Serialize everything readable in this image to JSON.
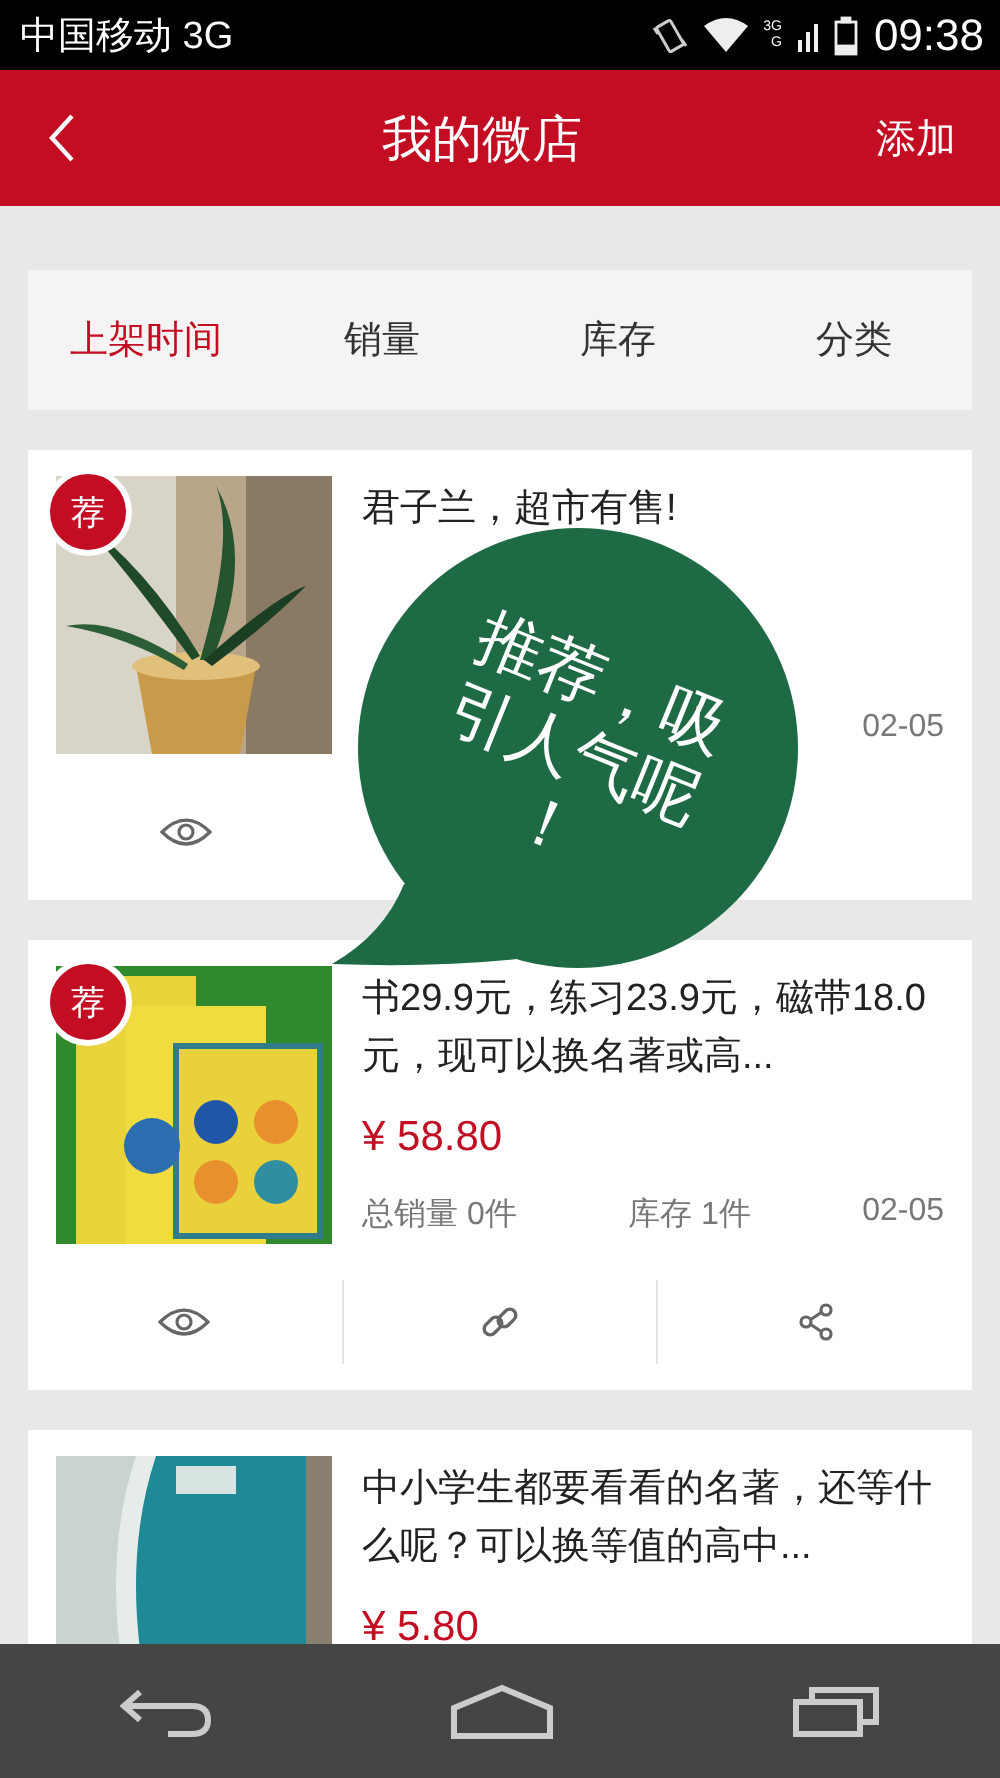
{
  "status_bar": {
    "carrier": "中国移动 3G",
    "network_labels": [
      "3G",
      "G"
    ],
    "time": "09:38"
  },
  "header": {
    "title": "我的微店",
    "action": "添加"
  },
  "filters": [
    {
      "label": "上架时间",
      "selected": true
    },
    {
      "label": "销量",
      "selected": false
    },
    {
      "label": "库存",
      "selected": false
    },
    {
      "label": "分类",
      "selected": false
    }
  ],
  "products": [
    {
      "recommended": true,
      "badge": "荐",
      "title": "君子兰，超市有售!",
      "date": "02-05",
      "actions": [
        {
          "kind": "view"
        }
      ]
    },
    {
      "recommended": true,
      "badge": "荐",
      "title": "书29.9元，练习23.9元，磁带18.0元，现可以换名著或高...",
      "price": "¥ 58.80",
      "sales": "总销量 0件",
      "stock": "库存 1件",
      "date": "02-05",
      "actions": [
        {
          "kind": "view"
        },
        {
          "kind": "link"
        },
        {
          "kind": "share"
        }
      ]
    },
    {
      "recommended": false,
      "title": "中小学生都要看看的名著，还等什么呢？可以换等值的高中...",
      "price": "¥ 5.80"
    }
  ],
  "callout": {
    "text": "推荐，吸引人气呢！"
  }
}
